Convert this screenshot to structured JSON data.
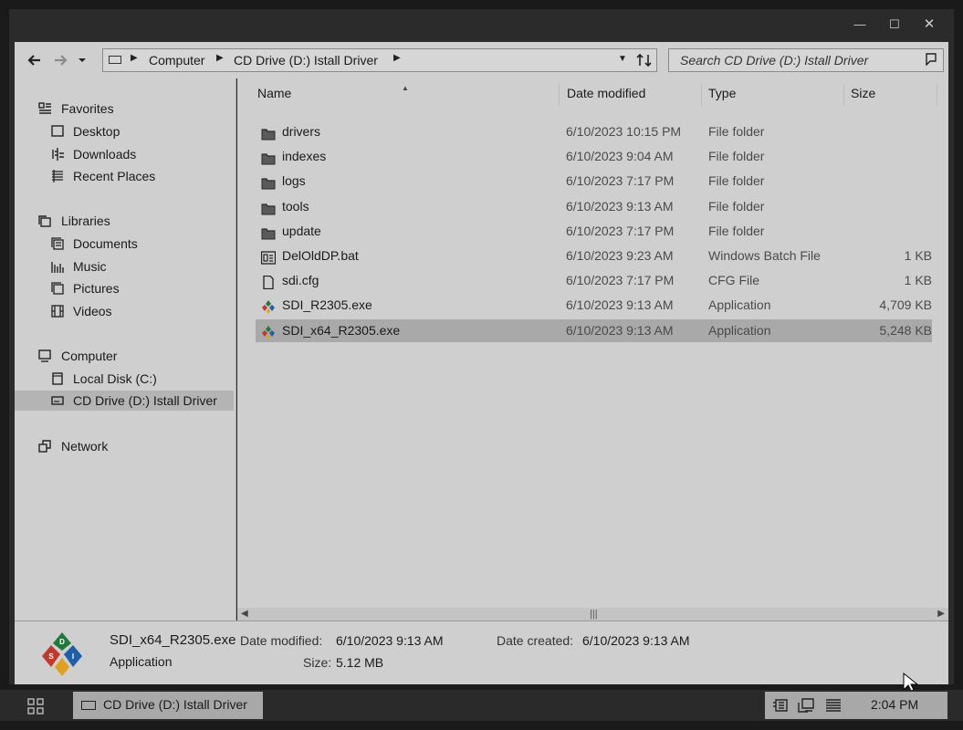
{
  "window": {
    "min_glyph": "—",
    "max_glyph": "☐",
    "close_glyph": "✕"
  },
  "navbar": {
    "back_icon": "arrow-left-icon",
    "forward_icon": "arrow-right-icon",
    "recent_icon": "chevron-down-icon",
    "breadcrumbs": [
      "Computer",
      "CD Drive (D:) Istall Driver"
    ],
    "refresh_icon": "refresh-icon"
  },
  "search": {
    "placeholder": "Search CD Drive (D:) Istall Driver"
  },
  "nav_pane": {
    "favorites": {
      "label": "Favorites",
      "items": [
        "Desktop",
        "Downloads",
        "Recent Places"
      ]
    },
    "libraries": {
      "label": "Libraries",
      "items": [
        "Documents",
        "Music",
        "Pictures",
        "Videos"
      ]
    },
    "computer": {
      "label": "Computer",
      "items": [
        "Local Disk (C:)",
        "CD Drive (D:) Istall Driver"
      ]
    },
    "network": {
      "label": "Network"
    }
  },
  "columns": {
    "name": "Name",
    "date": "Date modified",
    "type": "Type",
    "size": "Size"
  },
  "files": [
    {
      "name": "drivers",
      "date": "6/10/2023 10:15 PM",
      "type": "File folder",
      "size": "",
      "icon": "folder-icon"
    },
    {
      "name": "indexes",
      "date": "6/10/2023 9:04 AM",
      "type": "File folder",
      "size": "",
      "icon": "folder-icon"
    },
    {
      "name": "logs",
      "date": "6/10/2023 7:17 PM",
      "type": "File folder",
      "size": "",
      "icon": "folder-icon"
    },
    {
      "name": "tools",
      "date": "6/10/2023 9:13 AM",
      "type": "File folder",
      "size": "",
      "icon": "folder-icon"
    },
    {
      "name": "update",
      "date": "6/10/2023 7:17 PM",
      "type": "File folder",
      "size": "",
      "icon": "folder-icon"
    },
    {
      "name": "DelOldDP.bat",
      "date": "6/10/2023 9:23 AM",
      "type": "Windows Batch File",
      "size": "1 KB",
      "icon": "batch-file-icon"
    },
    {
      "name": "sdi.cfg",
      "date": "6/10/2023 7:17 PM",
      "type": "CFG File",
      "size": "1 KB",
      "icon": "document-icon"
    },
    {
      "name": "SDI_R2305.exe",
      "date": "6/10/2023 9:13 AM",
      "type": "Application",
      "size": "4,709 KB",
      "icon": "sdi-app-icon"
    },
    {
      "name": "SDI_x64_R2305.exe",
      "date": "6/10/2023 9:13 AM",
      "type": "Application",
      "size": "5,248 KB",
      "icon": "sdi-app-icon",
      "selected": true
    }
  ],
  "details": {
    "name": "SDI_x64_R2305.exe",
    "type": "Application",
    "modified_label": "Date modified:",
    "modified_value": "6/10/2023 9:13 AM",
    "created_label": "Date created:",
    "created_value": "6/10/2023 9:13 AM",
    "size_label": "Size:",
    "size_value": "5.12 MB"
  },
  "taskbar": {
    "app_label": "CD Drive (D:) Istall Driver",
    "clock": "2:04 PM"
  },
  "colors": {
    "selection": "#a9a9a9",
    "pane": "#cfcfcf",
    "frame": "#2b2b2b"
  }
}
